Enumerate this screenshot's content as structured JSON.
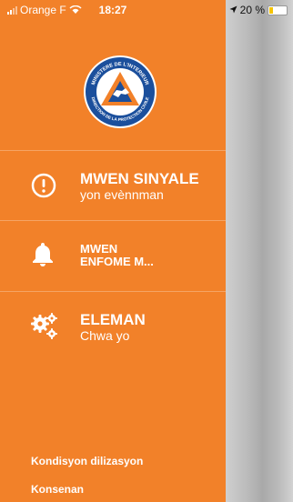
{
  "status_bar": {
    "carrier": "Orange F",
    "time": "18:27",
    "battery": "20 %",
    "battery_level": 0.2
  },
  "logo": {
    "arc_top": "MINISTERE DE L'INTERIEUR",
    "arc_bottom": "DIRECTION DE LA PROTECTION CIVILE",
    "colors": {
      "blue": "#1B4F9C",
      "orange": "#F28129"
    }
  },
  "menu": [
    {
      "icon": "alert-circle-icon",
      "title": "MWEN SINYALE",
      "subtitle": "yon evènnman"
    },
    {
      "icon": "bell-icon",
      "title_line1": "MWEN",
      "title_line2": "ENFOME M..."
    },
    {
      "icon": "gears-icon",
      "title": "ELEMAN",
      "subtitle": "Chwa yo"
    }
  ],
  "footer": {
    "terms": "Kondisyon dilizasyon",
    "consent": "Konsenan"
  },
  "colors": {
    "drawer_bg": "#F28129"
  }
}
